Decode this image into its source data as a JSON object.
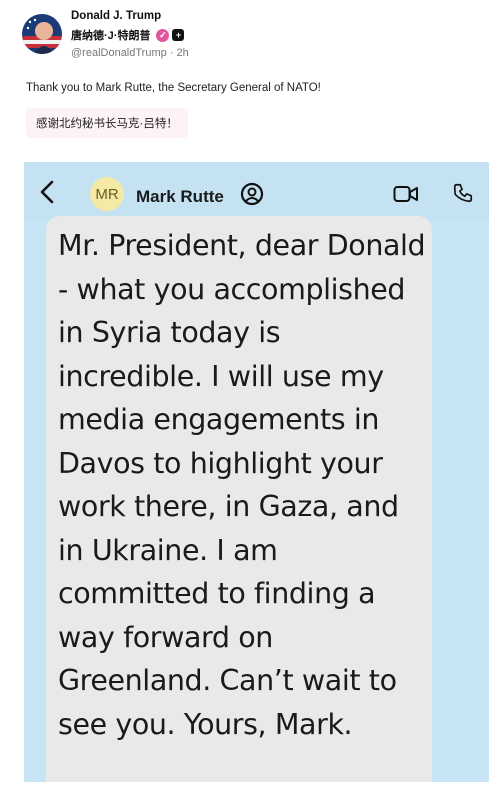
{
  "post": {
    "author": {
      "display_name": "Donald J. Trump",
      "chinese_name": "唐纳德·J·特朗普",
      "handle": "@realDonaldTrump",
      "time": "2h"
    },
    "text": "Thank you to Mark Rutte, the Secretary General of NATO!",
    "translation": "感谢北约秘书长马克·吕特！"
  },
  "screenshot": {
    "avatar_initials": "MR",
    "contact_name": "Mark Rutte",
    "message": "Mr. President, dear Donald - what you accomplished in Syria today is incredible. I will use my media engagements in Davos to highlight your work there, in Gaza, and in Ukraine. I am committed to finding a way forward on Greenland. Can’t wait to see you. Yours, Mark."
  },
  "icons": {
    "avatar": "flag-portrait",
    "verified": "verified-badge-icon",
    "affiliate": "plus-square-icon",
    "back": "chevron-left-icon",
    "contact": "person-circle-icon",
    "video": "video-camera-icon",
    "call": "phone-icon"
  },
  "colors": {
    "screenshot_background": "#c7e5f4",
    "bubble": "#e9e9e9",
    "verified_badge": "#e0589c",
    "translation_background": "#fdf2f4"
  }
}
